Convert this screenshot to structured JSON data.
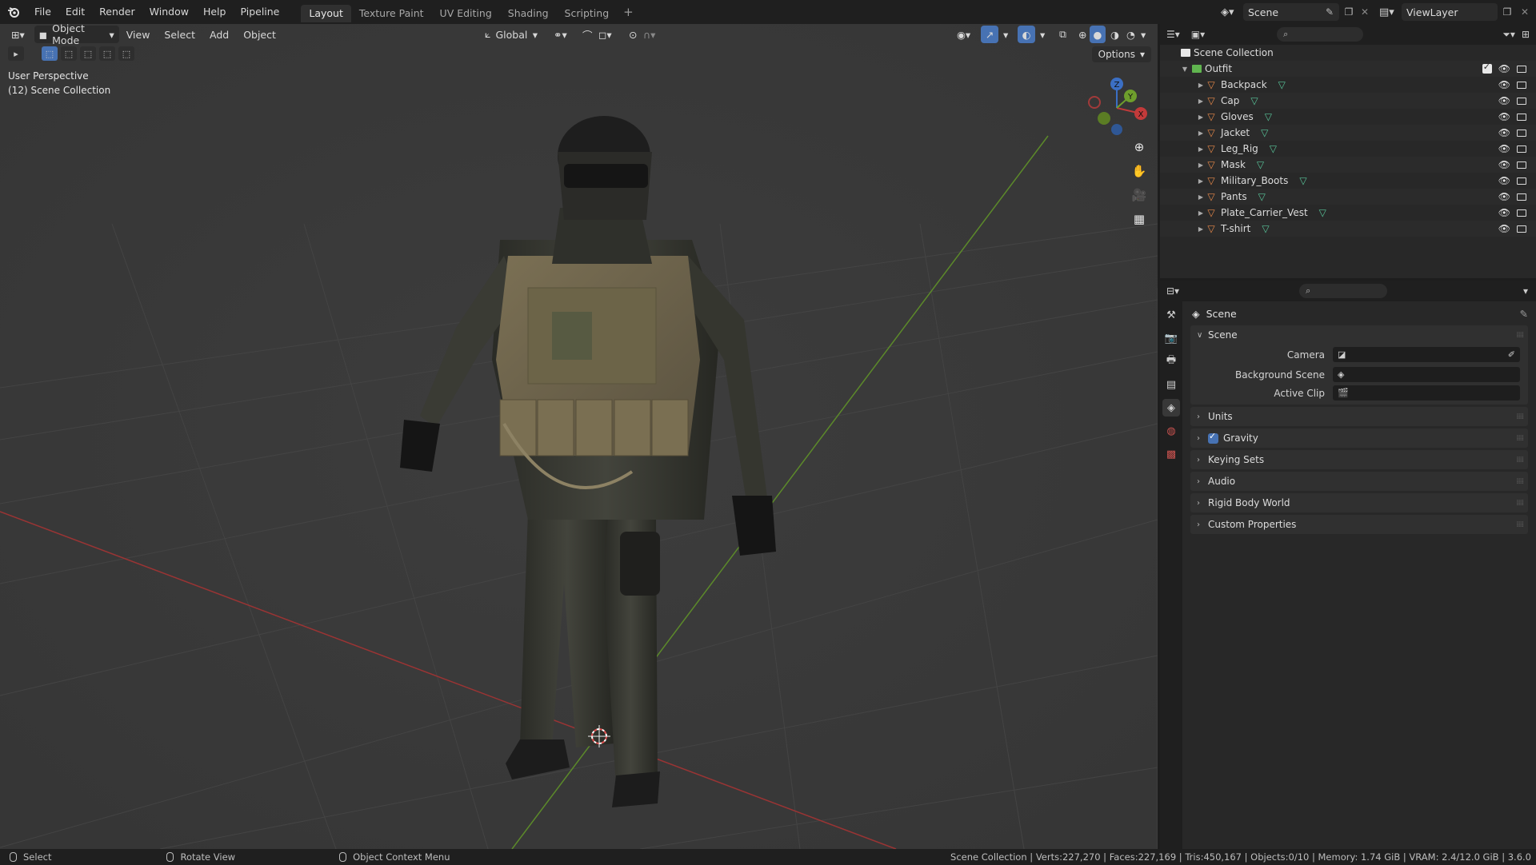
{
  "topbar": {
    "menus": [
      "File",
      "Edit",
      "Render",
      "Window",
      "Help",
      "Pipeline"
    ],
    "workspaces": [
      "Layout",
      "Texture Paint",
      "UV Editing",
      "Shading",
      "Scripting"
    ],
    "active_workspace": "Layout",
    "scene_name": "Scene",
    "view_layer": "ViewLayer"
  },
  "viewport": {
    "mode": "Object Mode",
    "menus": [
      "View",
      "Select",
      "Add",
      "Object"
    ],
    "transform_orientation": "Global",
    "options_label": "Options",
    "info_line1": "User Perspective",
    "info_line2": "(12) Scene Collection",
    "gizmo_axes": [
      "X",
      "Y",
      "Z"
    ]
  },
  "outliner": {
    "root": "Scene Collection",
    "collection": "Outfit",
    "objects": [
      "Backpack",
      "Cap",
      "Gloves",
      "Jacket",
      "Leg_Rig",
      "Mask",
      "Military_Boots",
      "Pants",
      "Plate_Carrier_Vest",
      "T-shirt"
    ]
  },
  "properties": {
    "context": "Scene",
    "panel_scene": "Scene",
    "camera_label": "Camera",
    "background_scene_label": "Background Scene",
    "active_clip_label": "Active Clip",
    "panels": [
      "Units",
      "Gravity",
      "Keying Sets",
      "Audio",
      "Rigid Body World",
      "Custom Properties"
    ]
  },
  "statusbar": {
    "left1": "Select",
    "left2": "Rotate View",
    "left3": "Object Context Menu",
    "stats": "Scene Collection | Verts:227,270 | Faces:227,169 | Tris:450,167 | Objects:0/10 | Memory: 1.74 GiB | VRAM: 2.4/12.0 GiB | 3.6.0"
  },
  "colors": {
    "accent": "#4772b3",
    "x_axis": "#c23a3a",
    "y_axis": "#6e9e2c",
    "mesh_icon": "#e8894a",
    "collection_green": "#60b54f"
  }
}
